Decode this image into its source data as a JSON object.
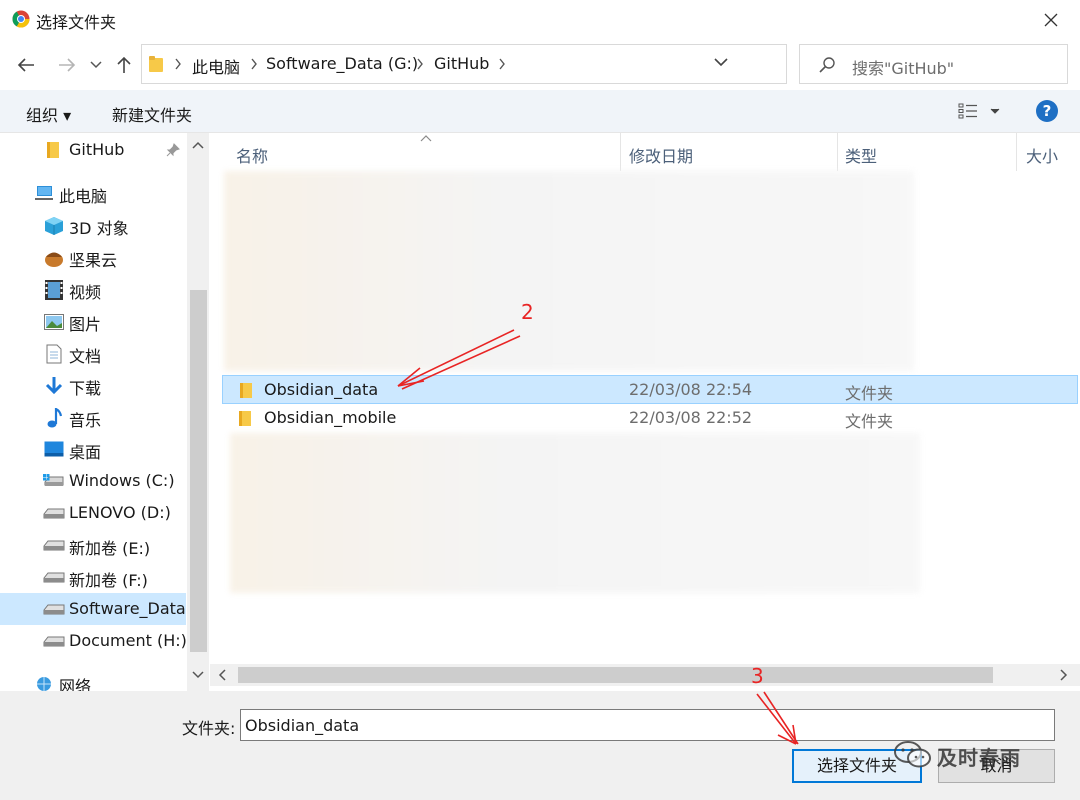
{
  "window": {
    "title": "选择文件夹",
    "app_icon": "chrome-icon",
    "close_icon": "close-icon"
  },
  "nav": {
    "back_icon": "arrow-left-icon",
    "forward_icon": "arrow-right-icon",
    "recent_icon": "chevron-down-icon",
    "up_icon": "arrow-up-icon",
    "breadcrumbs": [
      "此电脑",
      "Software_Data (G:)",
      "GitHub"
    ],
    "refresh_icon": "refresh-icon",
    "search_placeholder": "搜索\"GitHub\""
  },
  "commandbar": {
    "organize": "组织 ▾",
    "new_folder": "新建文件夹",
    "view_icon": "view-details-icon",
    "help": "?"
  },
  "sidebar": {
    "items": [
      {
        "label": "GitHub",
        "icon": "folder-icon"
      },
      {
        "label": "此电脑",
        "icon": "computer-icon"
      },
      {
        "label": "3D 对象",
        "icon": "cube-icon"
      },
      {
        "label": "坚果云",
        "icon": "nutstore-icon"
      },
      {
        "label": "视频",
        "icon": "video-icon"
      },
      {
        "label": "图片",
        "icon": "picture-icon"
      },
      {
        "label": "文档",
        "icon": "document-icon"
      },
      {
        "label": "下载",
        "icon": "download-icon"
      },
      {
        "label": "音乐",
        "icon": "music-icon"
      },
      {
        "label": "桌面",
        "icon": "desktop-icon"
      },
      {
        "label": "Windows (C:)",
        "icon": "drive-icon"
      },
      {
        "label": "LENOVO (D:)",
        "icon": "drive-icon"
      },
      {
        "label": "新加卷 (E:)",
        "icon": "drive-icon"
      },
      {
        "label": "新加卷 (F:)",
        "icon": "drive-icon"
      },
      {
        "label": "Software_Data (G:)",
        "icon": "drive-icon"
      },
      {
        "label": "Document (H:)",
        "icon": "drive-icon"
      },
      {
        "label": "网络",
        "icon": "network-icon"
      }
    ]
  },
  "filelist": {
    "columns": [
      "名称",
      "修改日期",
      "类型",
      "大小"
    ],
    "rows": [
      {
        "name": "Obsidian_data",
        "modified": "22/03/08 22:54",
        "type": "文件夹",
        "selected": true
      },
      {
        "name": "Obsidian_mobile",
        "modified": "22/03/08 22:52",
        "type": "文件夹",
        "selected": false
      }
    ]
  },
  "footer": {
    "folder_label": "文件夹:",
    "folder_value": "Obsidian_data",
    "select_button": "选择文件夹",
    "cancel_button": "取消"
  },
  "annotations": {
    "marker_2": "2",
    "marker_3": "3",
    "color": "#e82424"
  },
  "watermark": {
    "text": "及时春雨",
    "icon": "wechat-icon"
  },
  "colors": {
    "selection": "#cce8ff",
    "accent": "#0078d7",
    "folder": "#f7c948"
  }
}
